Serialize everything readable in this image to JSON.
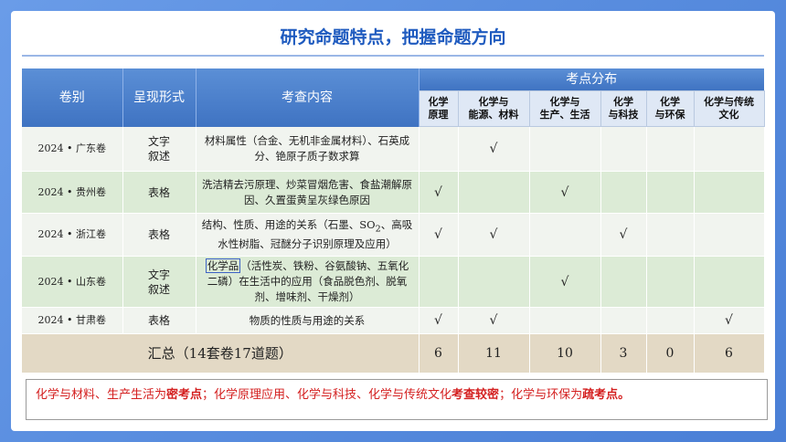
{
  "title": "研究命题特点，把握命题方向",
  "headers": {
    "volume": "卷别",
    "form": "呈现形式",
    "content": "考查内容",
    "distribution": "考点分布",
    "categories": [
      {
        "line1": "化学",
        "line2": "原理"
      },
      {
        "line1": "化学与",
        "line2": "能源、材料"
      },
      {
        "line1": "化学与",
        "line2": "生产、生活"
      },
      {
        "line1": "化学",
        "line2": "与科技"
      },
      {
        "line1": "化学",
        "line2": "与环保"
      },
      {
        "line1": "化学与传统",
        "line2": "文化"
      }
    ]
  },
  "rows": [
    {
      "volume": "2024 • 广东卷",
      "form_line1": "文字",
      "form_line2": "叙述",
      "content": "材料属性（合金、无机非金属材料）、石英成分、铯原子质子数求算",
      "ticks": [
        "",
        "√",
        "",
        "",
        "",
        ""
      ]
    },
    {
      "volume": "2024 • 贵州卷",
      "form_line1": "表格",
      "form_line2": "",
      "content": "洗洁精去污原理、炒菜冒烟危害、食盐潮解原因、久置蛋黄呈灰绿色原因",
      "ticks": [
        "√",
        "",
        "√",
        "",
        "",
        ""
      ]
    },
    {
      "volume": "2024 • 浙江卷",
      "form_line1": "表格",
      "form_line2": "",
      "content_pre": "结构、性质、用途的关系（石墨、SO",
      "content_sub": "2",
      "content_post": "、高吸水性树脂、冠醚分子识别原理及应用）",
      "ticks": [
        "√",
        "√",
        "",
        "√",
        "",
        ""
      ]
    },
    {
      "volume": "2024 • 山东卷",
      "form_line1": "文字",
      "form_line2": "叙述",
      "content_hl": "化学品",
      "content": "（活性炭、铁粉、谷氨酸钠、五氧化二磷）在生活中的应用（食品脱色剂、脱氧剂、增味剂、干燥剂）",
      "ticks": [
        "",
        "",
        "√",
        "",
        "",
        ""
      ]
    },
    {
      "volume": "2024 • 甘肃卷",
      "form_line1": "表格",
      "form_line2": "",
      "content": "物质的性质与用途的关系",
      "ticks": [
        "√",
        "√",
        "",
        "",
        "",
        "√"
      ]
    }
  ],
  "summary": {
    "label": "汇总（14套卷17道题）",
    "values": [
      "6",
      "11",
      "10",
      "3",
      "0",
      "6"
    ]
  },
  "note": {
    "p1": "化学与材料、生产生活为",
    "b1": "密考点",
    "p2": "；化学原理应用、化学与科技、化学与传统文化",
    "b2": "考查较密",
    "p3": "；化学与环保为",
    "b3": "疏考点。"
  },
  "colors": {
    "title": "#1f5bbf",
    "header": "#4a7fd0",
    "note_text": "#d42020",
    "summary_bg": "#e3d9c5"
  }
}
